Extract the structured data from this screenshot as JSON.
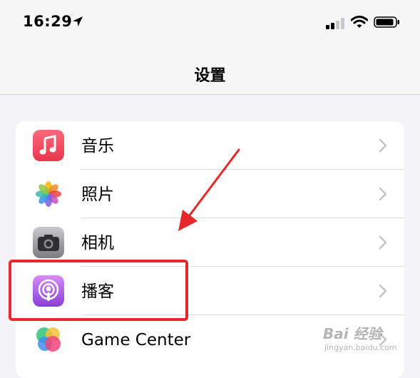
{
  "status_bar": {
    "time": "16:29"
  },
  "nav": {
    "title": "设置"
  },
  "settings": {
    "items": [
      {
        "label": "音乐",
        "icon": "music-icon"
      },
      {
        "label": "照片",
        "icon": "photos-icon"
      },
      {
        "label": "相机",
        "icon": "camera-icon"
      },
      {
        "label": "播客",
        "icon": "podcasts-icon"
      },
      {
        "label": "Game Center",
        "icon": "game-center-icon"
      }
    ]
  },
  "annotation": {
    "color": "#e8272b",
    "highlighted_item": "播客"
  },
  "watermark": {
    "brand": "Bai 经验",
    "url": "jingyan.baidu.com"
  },
  "colors": {
    "background": "#f2f2f7",
    "music": "#f0445a",
    "podcasts": "#a55ee3",
    "chevron": "#c4c4c6",
    "annotation": "#e8272b"
  }
}
